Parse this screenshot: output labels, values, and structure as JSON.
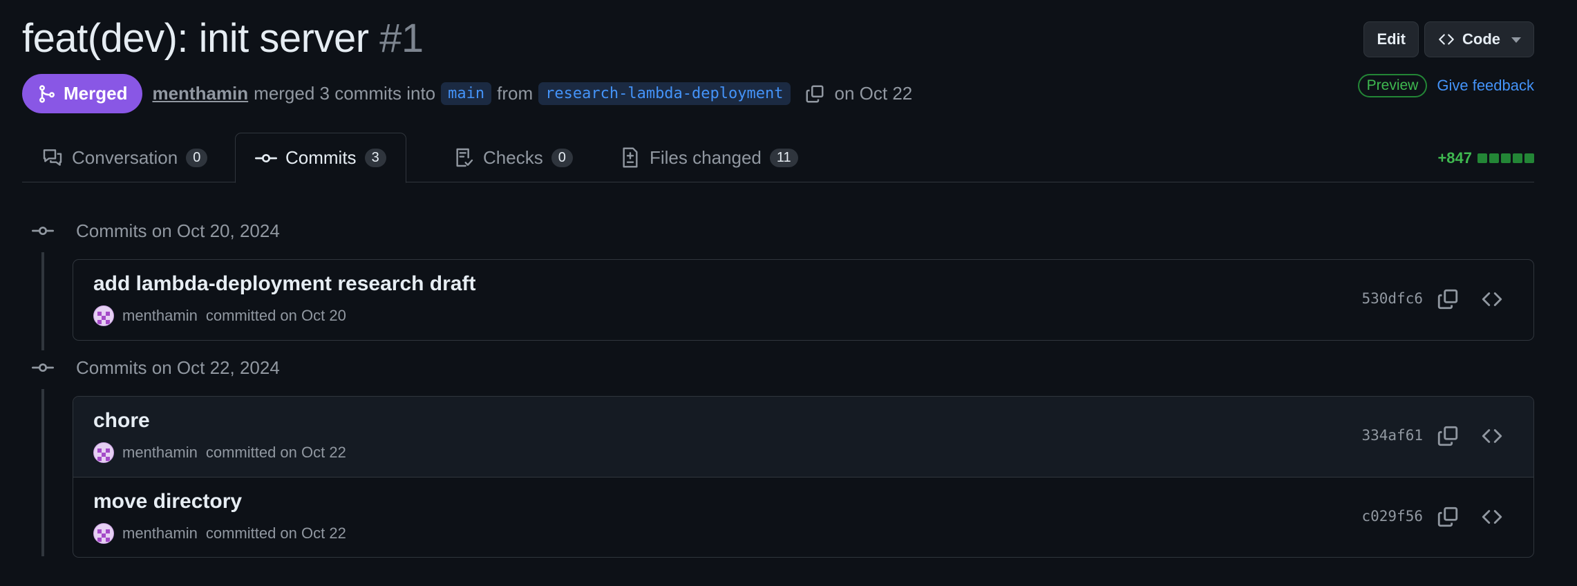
{
  "pr": {
    "title": "feat(dev): init server",
    "number": "#1",
    "state": "Merged",
    "author": "menthamin",
    "merge_text_1": "merged 3 commits into",
    "base_branch": "main",
    "from_text": "from",
    "head_branch": "research-lambda-deployment",
    "date_text": "on Oct 22"
  },
  "header_actions": {
    "edit_label": "Edit",
    "code_label": "Code"
  },
  "preview": {
    "badge": "Preview",
    "feedback": "Give feedback"
  },
  "tabs": [
    {
      "label": "Conversation",
      "count": "0",
      "icon": "comment-discussion-icon"
    },
    {
      "label": "Commits",
      "count": "3",
      "icon": "git-commit-icon",
      "active": true
    },
    {
      "label": "Checks",
      "count": "0",
      "icon": "checklist-icon"
    },
    {
      "label": "Files changed",
      "count": "11",
      "icon": "file-diff-icon"
    }
  ],
  "diffstat": {
    "additions": "+847"
  },
  "groups": [
    {
      "heading": "Commits on Oct 20, 2024",
      "commits": [
        {
          "title": "add lambda-deployment research draft",
          "author": "menthamin",
          "meta": "committed on Oct 20",
          "sha": "530dfc6"
        }
      ]
    },
    {
      "heading": "Commits on Oct 22, 2024",
      "commits": [
        {
          "title": "chore",
          "author": "menthamin",
          "meta": "committed on Oct 22",
          "sha": "334af61"
        },
        {
          "title": "move directory",
          "author": "menthamin",
          "meta": "committed on Oct 22",
          "sha": "c029f56"
        }
      ]
    }
  ],
  "colors": {
    "background": "#0d1117",
    "merged": "#8957e5",
    "link": "#4493f8",
    "success": "#3fb950"
  }
}
